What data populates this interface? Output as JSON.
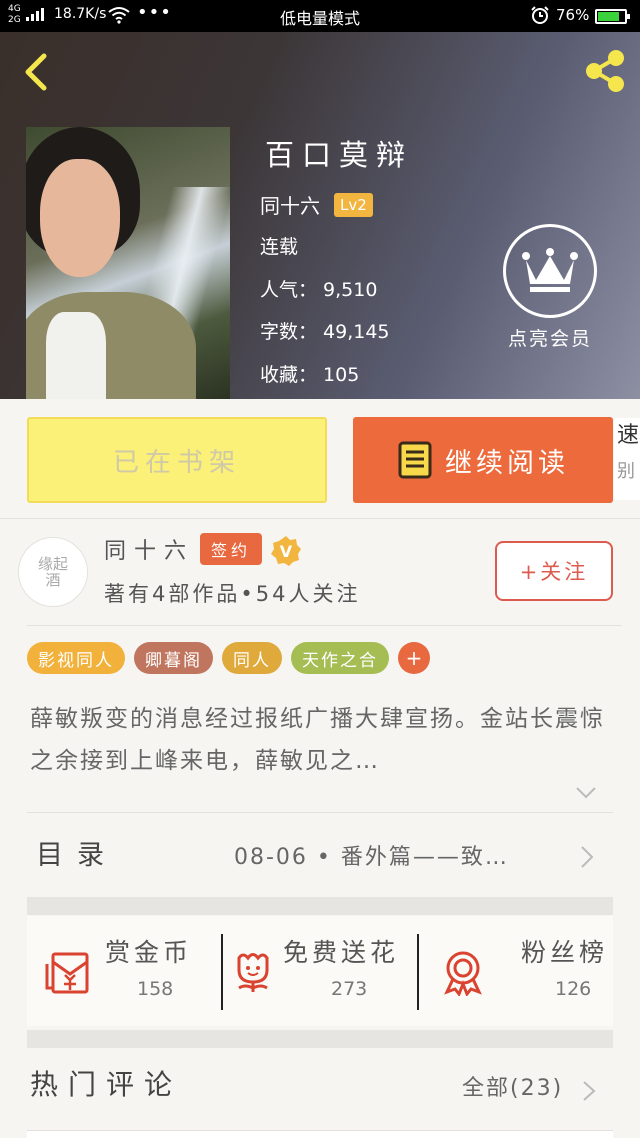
{
  "status_bar": {
    "network_type": "4G",
    "network_type_2": "2G",
    "speed": "18.7K/s",
    "more": "•••",
    "mode": "低电量模式",
    "battery": "76%",
    "battery_level": 0.76
  },
  "book": {
    "title": "百口莫辩",
    "author": "同十六",
    "level": "Lv2",
    "status": "连载",
    "popularity": "人气： 9,510",
    "word_count": "字数： 49,145",
    "favorites": "收藏： 105"
  },
  "vip": {
    "label": "点亮会员"
  },
  "actions": {
    "shelf_label": "已在书架",
    "read_label": "继续阅读",
    "side_peek_1": "速",
    "side_peek_2": "别"
  },
  "author_card": {
    "avatar_text_1": "缘起",
    "avatar_text_2": "酒",
    "name": "同十六",
    "sign_badge": "签约",
    "meta": "著有4部作品•54人关注",
    "follow_label": "+关注"
  },
  "tags": [
    {
      "label": "影视同人",
      "color": "#f1b13b"
    },
    {
      "label": "卿暮阁",
      "color": "#c0765e"
    },
    {
      "label": "同人",
      "color": "#e0a93b"
    },
    {
      "label": "天作之合",
      "color": "#a5bd52"
    }
  ],
  "tag_more": "+",
  "description": "薛敏叛变的消息经过报纸广播大肆宣扬。金站长震惊之余接到上峰来电，薛敏见之…",
  "toc": {
    "label": "目录",
    "latest": "08-06 • 番外篇——致…"
  },
  "stats": [
    {
      "label": "赏金币",
      "value": "158",
      "icon": "red-envelope-icon"
    },
    {
      "label": "免费送花",
      "value": "273",
      "icon": "flower-icon"
    },
    {
      "label": "粉丝榜",
      "value": "126",
      "icon": "medal-icon"
    }
  ],
  "comments": {
    "title": "热门评论",
    "all_label": "全部(23)"
  },
  "colors": {
    "accent": "#ec6a3c",
    "shelf_yellow": "#fbf078",
    "follow_red": "#dc5b4e"
  }
}
